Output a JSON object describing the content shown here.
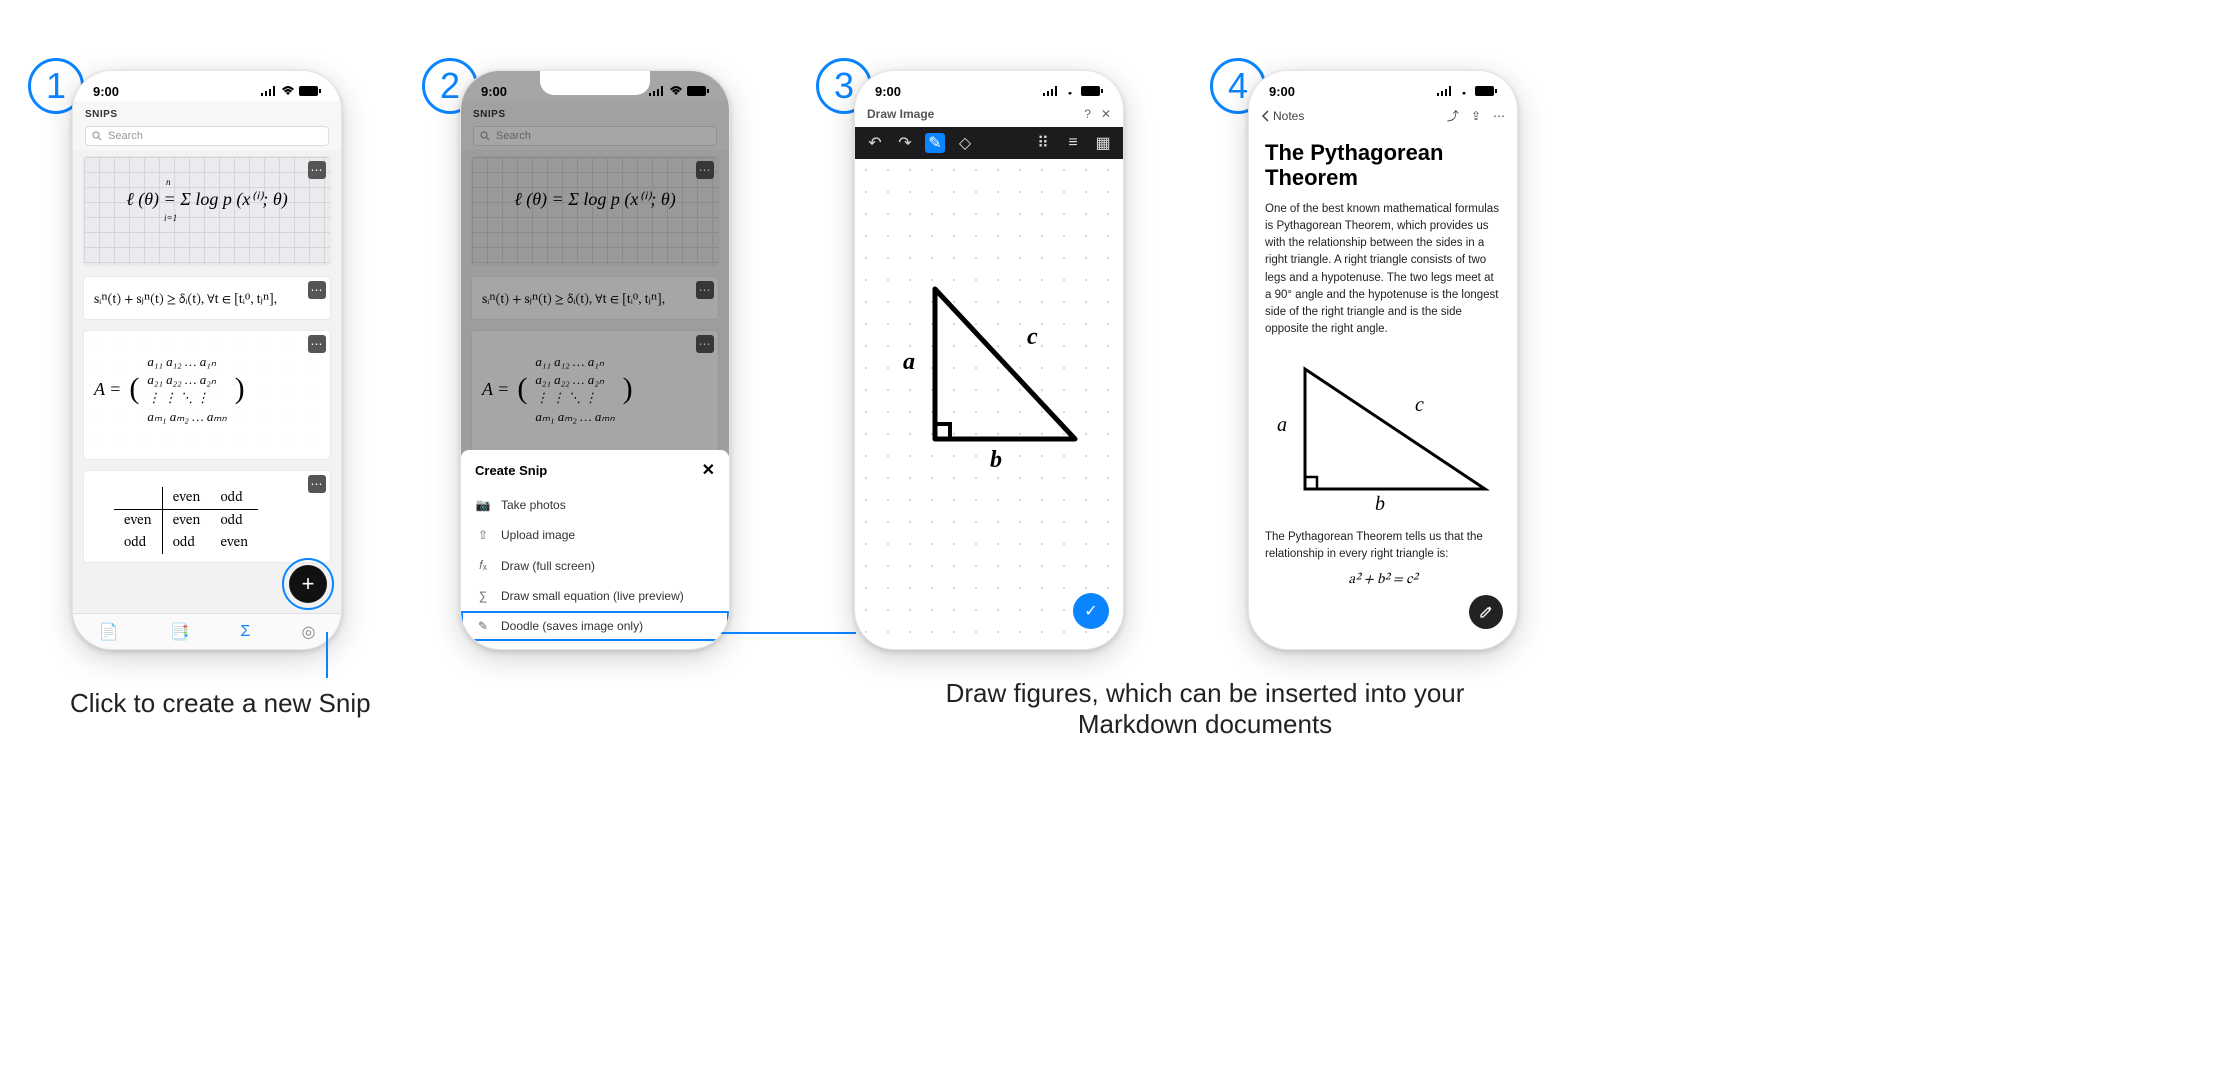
{
  "status": {
    "time": "9:00"
  },
  "captions": {
    "c1": "Click to create a new Snip",
    "c2": "Draw figures, which can be inserted into your",
    "c2b": "Markdown documents"
  },
  "steps": [
    "1",
    "2",
    "3",
    "4"
  ],
  "phone1": {
    "header": "SNIPS",
    "search_placeholder": "Search",
    "formula2": "sᵢⁿ(t) + sⱼⁿ(t) ≥ δᵢ(t),   ∀t ∈ [tᵢ⁰, tⱼⁿ],",
    "table": {
      "h1": "even",
      "h2": "odd",
      "r1": "even",
      "r1a": "even",
      "r1b": "odd",
      "r2": "odd",
      "r2a": "odd",
      "r2b": "even"
    },
    "math_card1_line": "ℓ (θ) = Σ log p (x⁽ⁱ⁾; θ)",
    "math_card1_top": "n",
    "math_card1_bot": "i=1",
    "matrix_prefix": "A  =",
    "matrix_rows": [
      "a₁₁   a₁₂  …  a₁ₙ",
      "a₂₁   a₂₂ …  a₂ₙ",
      "⋮       ⋮    ⋱    ⋮",
      "aₘ₁  aₘ₂ … aₘₙ"
    ]
  },
  "phone2": {
    "sheet_title": "Create Snip",
    "items": [
      "Take photos",
      "Upload image",
      "Draw (full screen)",
      "Draw small equation (live preview)",
      "Doodle (saves image only)"
    ]
  },
  "phone3": {
    "title": "Draw Image",
    "labels": {
      "a": "a",
      "b": "b",
      "c": "c"
    }
  },
  "phone4": {
    "back": "Notes",
    "title": "The Pythagorean Theorem",
    "para1": "One of the best known mathematical formulas is Pythagorean Theorem, which provides us with the relationship between the sides in a right triangle. A right triangle consists of two legs and a hypotenuse. The two legs meet at a 90° angle and the hypotenuse is the longest side of the right triangle and is the side opposite the right angle.",
    "para2": "The Pythagorean Theorem tells us that the relationship in every right triangle is:",
    "eq": "a² + b² = c²",
    "labels": {
      "a": "a",
      "b": "b",
      "c": "c"
    }
  }
}
